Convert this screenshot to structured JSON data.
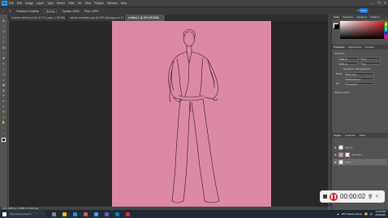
{
  "app": {
    "logo": "Ps"
  },
  "menubar": {
    "items": [
      "File",
      "Edit",
      "Image",
      "Layer",
      "Type",
      "Select",
      "Filter",
      "3D",
      "View",
      "Plugins",
      "Window",
      "Help"
    ],
    "window_controls": [
      "—",
      "❐",
      "✕"
    ]
  },
  "options": {
    "tool_label": "Transform Controls",
    "mode": "Normal",
    "opacity_label": "Opacity: 100%",
    "flow_label": "Flow: 100%",
    "share_label": "Share"
  },
  "tabs": [
    {
      "label": "Fashion sketch.psd @ 16.7% (Layer 1, RGB/8)",
      "active": false
    },
    {
      "label": "fashion-templates.psd @ 25% (Background, RGB/8)",
      "active": false
    },
    {
      "label": "Untitled-1 @ 25% (RGB/8)",
      "active": true
    }
  ],
  "status": {
    "zoom_text": "25% 2480 px x 3508 px (300 ppi)"
  },
  "right_panel": {
    "top_tabs": [
      "Color",
      "Swatches",
      "Gradients",
      "Patterns"
    ],
    "prop_tabs": [
      "Properties",
      "Adjustments",
      "Libraries"
    ],
    "transform_label": "Transform",
    "w": "2480 px",
    "h": "3508 px",
    "x": "0 px",
    "y": "0 px",
    "resolution_label": "Resolution: 300 pixels/inch",
    "mode_label": "Mode",
    "mode_value": "RGB Color",
    "bits_value": "8 Bits/Channel",
    "fill_label": "Fill",
    "fill_value": "Transparent",
    "rulers_label": "Rulers & Grids",
    "layers_tabs": [
      "Layers",
      "Channels",
      "Paths"
    ],
    "layers": [
      {
        "name": "Layer 2",
        "selected": false,
        "thumb": "#ffffff"
      },
      {
        "name": "Color Fill 1",
        "selected": false,
        "thumb": "#dd89a6"
      },
      {
        "name": "Layer 1",
        "selected": true,
        "thumb": "#ffffff"
      }
    ]
  },
  "recorder": {
    "time": "00:00:02"
  },
  "taskbar": {
    "search_placeholder": "Type here to search",
    "weather": "29°F Mostly cloudy",
    "time": "12:54 PM",
    "date": "2/16/2023"
  },
  "colors": {
    "doc_pink": "#dd89a6",
    "accent": "#1473e6"
  }
}
